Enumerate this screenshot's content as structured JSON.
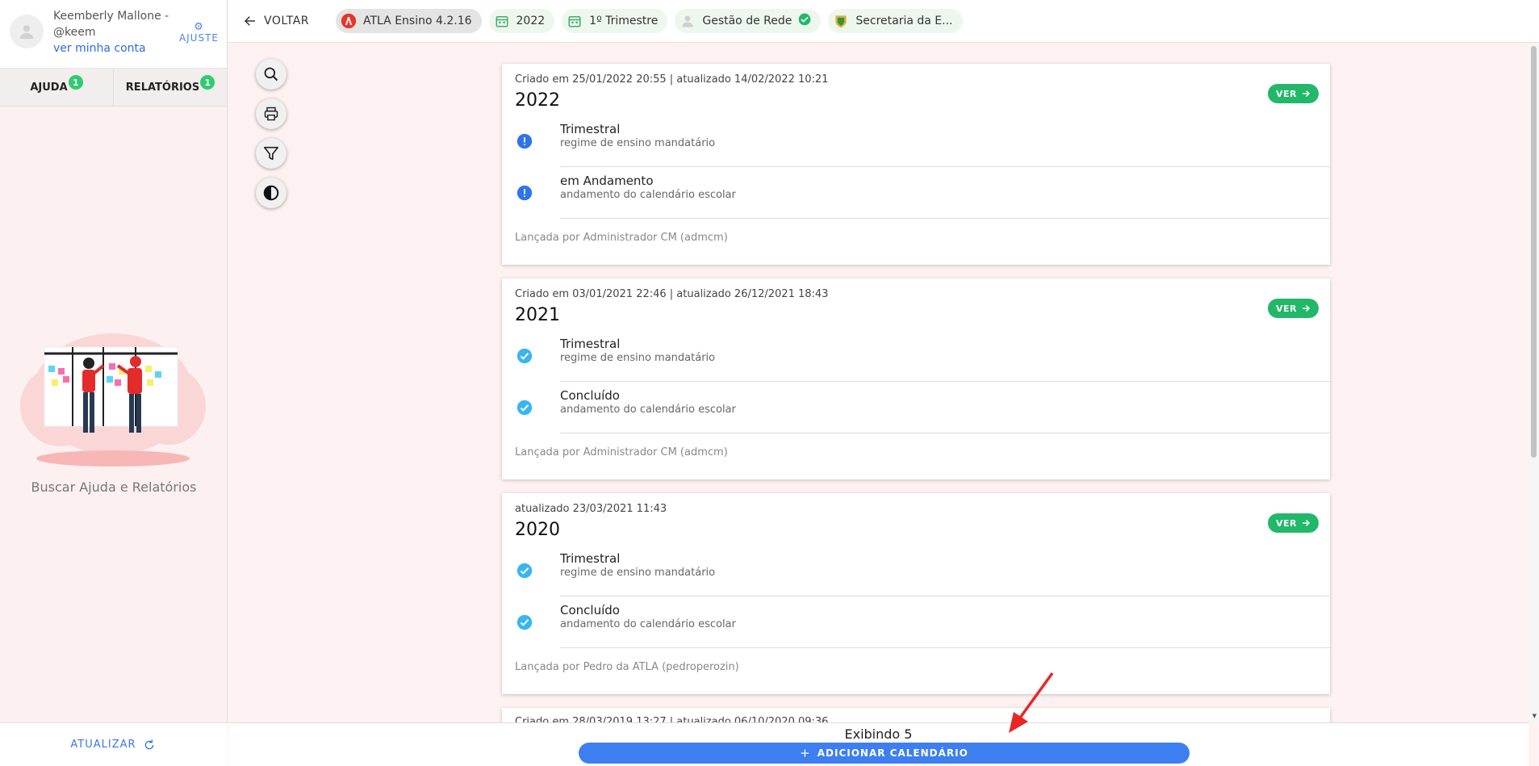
{
  "user": {
    "name": "Keemberly Mallone -",
    "handle": "@keem",
    "account_link": "ver minha conta",
    "settings_label": "AJUSTE"
  },
  "side_tabs": [
    {
      "label": "AJUDA",
      "badge": "1"
    },
    {
      "label": "RELATÓRIOS",
      "badge": "1"
    }
  ],
  "help_text": "Buscar Ajuda e Relatórios",
  "refresh_label": "ATUALIZAR",
  "topbar": {
    "back_label": "VOLTAR",
    "chips": [
      {
        "label": "ATLA Ensino 4.2.16",
        "icon": "atla-logo-icon"
      },
      {
        "label": "2022",
        "icon": "calendar-icon"
      },
      {
        "label": "1º Trimestre",
        "icon": "calendar-icon"
      },
      {
        "label": "Gestão de Rede",
        "icon": "person-icon"
      },
      {
        "label": "Secretaria da E...",
        "icon": "crest-icon"
      }
    ]
  },
  "tools": [
    "search-icon",
    "print-icon",
    "filter-icon",
    "contrast-icon"
  ],
  "cards": [
    {
      "meta": "Criado em 25/01/2022 20:55 | atualizado 14/02/2022 10:21",
      "year": "2022",
      "ver_label": "VER",
      "rows": [
        {
          "title": "Trimestral",
          "subtitle": "regime de ensino mandatário",
          "status": "info"
        },
        {
          "title": "em Andamento",
          "subtitle": "andamento do calendário escolar",
          "status": "info"
        }
      ],
      "footer": "Lançada por Administrador CM (admcm)"
    },
    {
      "meta": "Criado em 03/01/2021 22:46 | atualizado 26/12/2021 18:43",
      "year": "2021",
      "ver_label": "VER",
      "rows": [
        {
          "title": "Trimestral",
          "subtitle": "regime de ensino mandatário",
          "status": "check"
        },
        {
          "title": "Concluído",
          "subtitle": "andamento do calendário escolar",
          "status": "check"
        }
      ],
      "footer": "Lançada por Administrador CM (admcm)"
    },
    {
      "meta": "atualizado 23/03/2021 11:43",
      "year": "2020",
      "ver_label": "VER",
      "rows": [
        {
          "title": "Trimestral",
          "subtitle": "regime de ensino mandatário",
          "status": "check"
        },
        {
          "title": "Concluído",
          "subtitle": "andamento do calendário escolar",
          "status": "check"
        }
      ],
      "footer": "Lançada por Pedro da ATLA (pedroperozin)"
    }
  ],
  "peek_card_meta": "Criado em 28/03/2019 13:27 | atualizado 06/10/2020 09:36",
  "bottom": {
    "count_label": "Exibindo 5",
    "add_label": "ADICIONAR CALENDÁRIO"
  },
  "colors": {
    "accent_blue": "#3d7ff0",
    "green": "#22b869",
    "info_blue": "#2f74ea",
    "check_blue": "#37b6f2",
    "annotation_red": "#e82626"
  }
}
